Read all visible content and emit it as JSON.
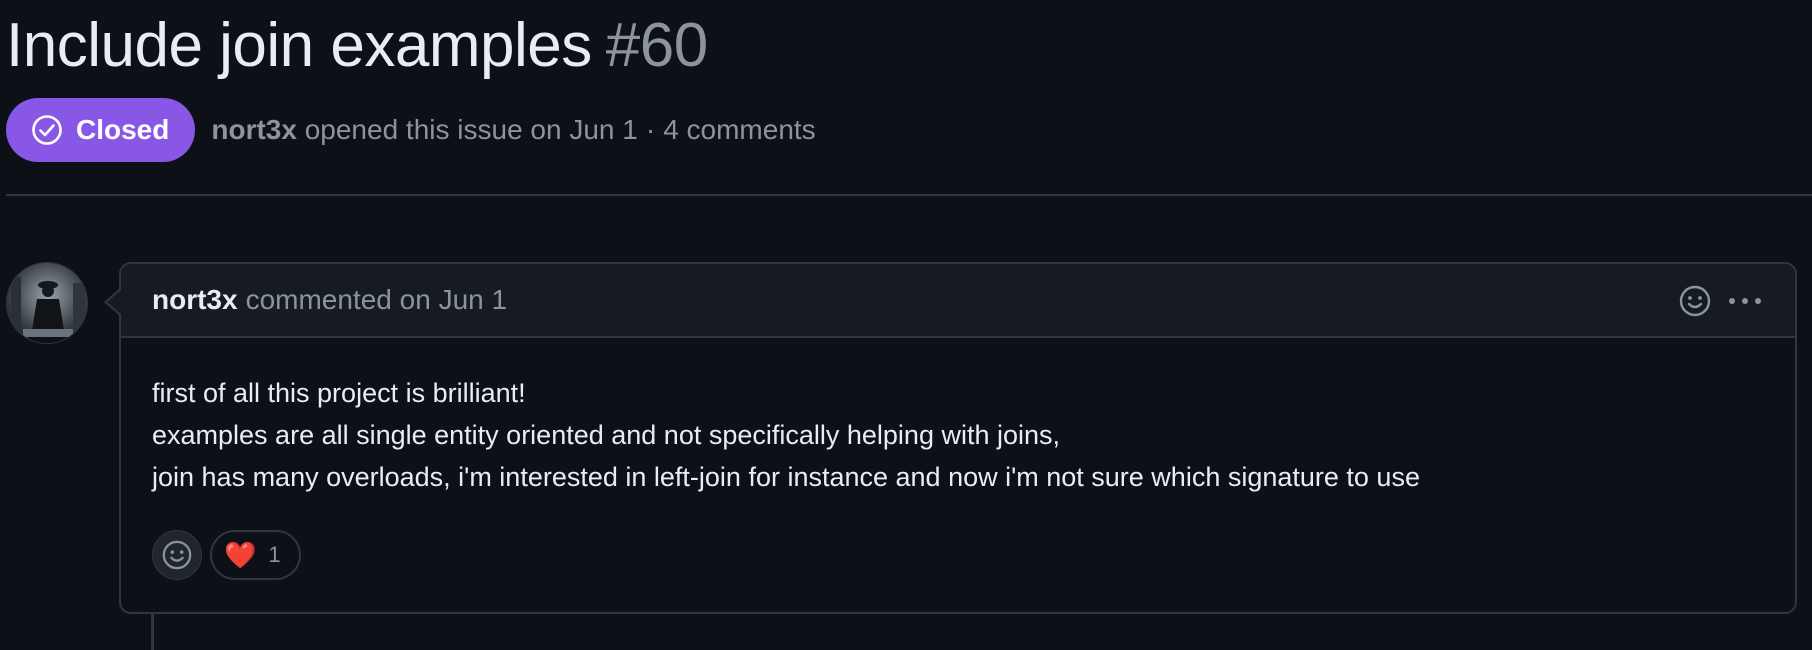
{
  "issue": {
    "title": "Include join examples",
    "number": "#60",
    "state": "Closed",
    "author": "nort3x",
    "opened_text": "opened this issue on Jun 1",
    "separator": "·",
    "comments_count": "4 comments"
  },
  "comment": {
    "author": "nort3x",
    "action": "commented on Jun 1",
    "body": [
      "first of all this project is brilliant!",
      "examples are all single entity oriented and not specifically helping with joins,",
      "join has many overloads, i'm interested in left-join for instance and now i'm not sure which signature to use"
    ],
    "reactions": [
      {
        "emoji": "❤️",
        "count": "1"
      }
    ]
  },
  "icons": {
    "state": "check-circle-icon",
    "header_reaction": "smiley-icon",
    "menu": "kebab-horizontal-icon",
    "add_reaction": "smiley-icon"
  },
  "colors": {
    "background": "#0d1117",
    "closed_badge": "#8957e5",
    "border": "#30363d",
    "muted_text": "#8b949e",
    "text": "#e6edf3"
  }
}
